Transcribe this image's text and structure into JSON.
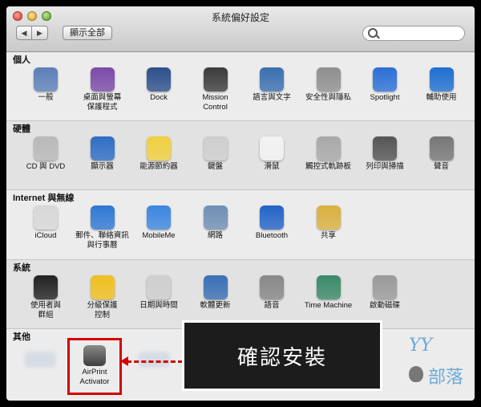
{
  "window": {
    "title": "系統偏好設定"
  },
  "toolbar": {
    "back": "◀",
    "forward": "▶",
    "show_all": "顯示全部"
  },
  "search": {
    "placeholder": ""
  },
  "sections": [
    {
      "title": "個人",
      "items": [
        {
          "label": "一般",
          "icon": "general-icon",
          "color": "#5d7fb7"
        },
        {
          "label": "桌面與螢幕\n保護程式",
          "icon": "desktop-icon",
          "color": "#7a4aa8"
        },
        {
          "label": "Dock",
          "icon": "dock-icon",
          "color": "#2d4f8a"
        },
        {
          "label": "Mission\nControl",
          "icon": "mission-control-icon",
          "color": "#3b3b3b"
        },
        {
          "label": "語言與文字",
          "icon": "language-icon",
          "color": "#3b6fb0"
        },
        {
          "label": "安全性與隱私",
          "icon": "security-icon",
          "color": "#8f8f8f"
        },
        {
          "label": "Spotlight",
          "icon": "spotlight-icon",
          "color": "#2c6fd6"
        },
        {
          "label": "輔助使用",
          "icon": "accessibility-icon",
          "color": "#1f6fd0"
        }
      ]
    },
    {
      "title": "硬體",
      "items": [
        {
          "label": "CD 與 DVD",
          "icon": "cd-dvd-icon",
          "color": "#b9b9b9"
        },
        {
          "label": "顯示器",
          "icon": "displays-icon",
          "color": "#2e6ec4"
        },
        {
          "label": "能源節約器",
          "icon": "energy-saver-icon",
          "color": "#f0d040"
        },
        {
          "label": "鍵盤",
          "icon": "keyboard-icon",
          "color": "#cfcfcf"
        },
        {
          "label": "滑鼠",
          "icon": "mouse-icon",
          "color": "#f2f2f2"
        },
        {
          "label": "觸控式軌跡板",
          "icon": "trackpad-icon",
          "color": "#a9a9a9"
        },
        {
          "label": "列印與掃描",
          "icon": "print-scan-icon",
          "color": "#555555"
        },
        {
          "label": "聲音",
          "icon": "sound-icon",
          "color": "#777777"
        }
      ]
    },
    {
      "title": "Internet 與無線",
      "items": [
        {
          "label": "iCloud",
          "icon": "icloud-icon",
          "color": "#d8d8d8"
        },
        {
          "label": "郵件、聯絡資訊\n與行事曆",
          "icon": "mail-contacts-icon",
          "color": "#2f78d4"
        },
        {
          "label": "MobileMe",
          "icon": "mobileme-icon",
          "color": "#3c86e0"
        },
        {
          "label": "網路",
          "icon": "network-icon",
          "color": "#6f8fb5"
        },
        {
          "label": "Bluetooth",
          "icon": "bluetooth-icon",
          "color": "#2364c7"
        },
        {
          "label": "共享",
          "icon": "sharing-icon",
          "color": "#d9b040"
        }
      ]
    },
    {
      "title": "系統",
      "items": [
        {
          "label": "使用者與\n群組",
          "icon": "users-groups-icon",
          "color": "#222222"
        },
        {
          "label": "分級保護\n控制",
          "icon": "parental-controls-icon",
          "color": "#f0c020"
        },
        {
          "label": "日期與時間",
          "icon": "date-time-icon",
          "color": "#cfcfcf"
        },
        {
          "label": "軟體更新",
          "icon": "software-update-icon",
          "color": "#3a6fb5"
        },
        {
          "label": "語音",
          "icon": "speech-icon",
          "color": "#888888"
        },
        {
          "label": "Time Machine",
          "icon": "time-machine-icon",
          "color": "#3b8a6a"
        },
        {
          "label": "啟動磁碟",
          "icon": "startup-disk-icon",
          "color": "#9a9a9a"
        }
      ]
    },
    {
      "title": "其他",
      "items": []
    }
  ],
  "other": {
    "airprint_label": "AirPrint\nActivator"
  },
  "callout": {
    "text": "確認安裝"
  },
  "brand": {
    "yy": "YY",
    "bu": "部落"
  }
}
